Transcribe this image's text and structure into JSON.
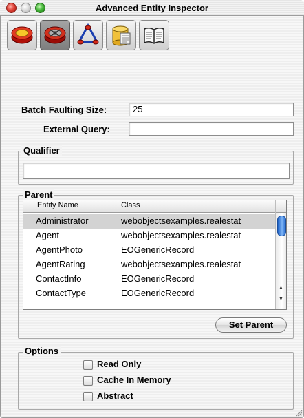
{
  "window": {
    "title": "Advanced Entity Inspector"
  },
  "toolbar": {
    "tools": [
      {
        "icon": "entity-attributes-icon",
        "selected": false
      },
      {
        "icon": "advanced-entity-icon",
        "selected": true
      },
      {
        "icon": "stored-procedures-icon",
        "selected": false
      },
      {
        "icon": "database-fetch-icon",
        "selected": false
      },
      {
        "icon": "user-info-book-icon",
        "selected": false
      }
    ]
  },
  "form": {
    "batch_faulting_label": "Batch Faulting Size:",
    "batch_faulting_value": "25",
    "external_query_label": "External Query:",
    "external_query_value": ""
  },
  "qualifier": {
    "title": "Qualifier",
    "value": ""
  },
  "parent": {
    "title": "Parent",
    "columns": [
      "Entity Name",
      "Class"
    ],
    "rows": [
      {
        "name": "Administrator",
        "class": "webobjectsexamples.realestat"
      },
      {
        "name": "Agent",
        "class": "webobjectsexamples.realestat"
      },
      {
        "name": "AgentPhoto",
        "class": "EOGenericRecord"
      },
      {
        "name": "AgentRating",
        "class": "webobjectsexamples.realestat"
      },
      {
        "name": "ContactInfo",
        "class": "EOGenericRecord"
      },
      {
        "name": "ContactType",
        "class": "EOGenericRecord"
      }
    ],
    "selected_row": "Administrator",
    "set_parent_label": "Set Parent"
  },
  "options": {
    "title": "Options",
    "items": [
      {
        "label": "Read Only",
        "checked": false
      },
      {
        "label": "Cache In Memory",
        "checked": false
      },
      {
        "label": "Abstract",
        "checked": false
      }
    ]
  }
}
